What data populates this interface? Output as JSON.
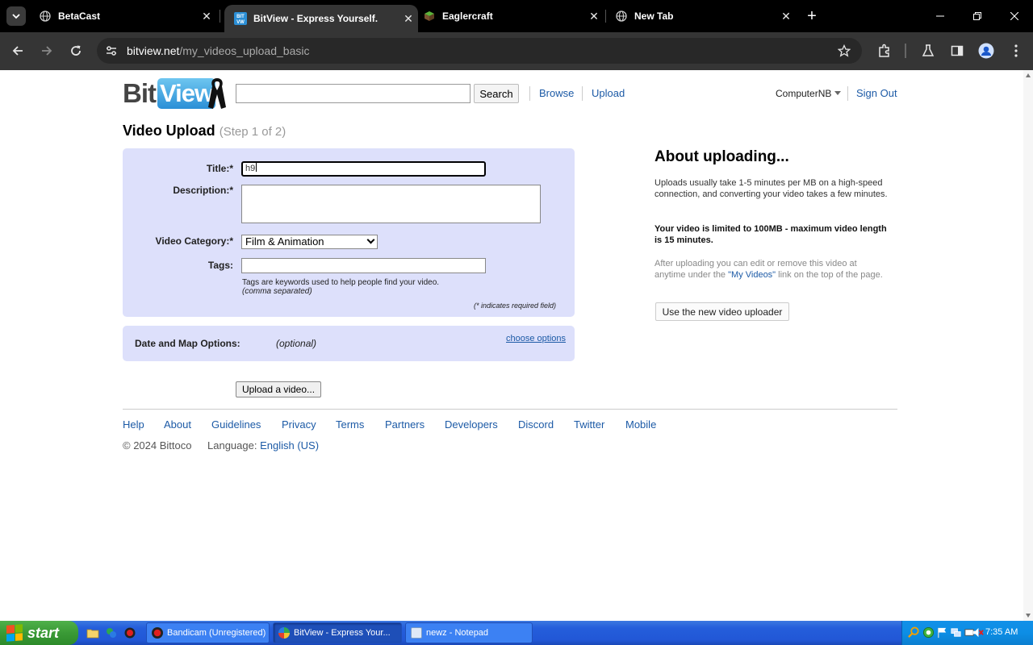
{
  "browser": {
    "tabs": [
      {
        "title": "BetaCast",
        "active": false
      },
      {
        "title": "BitView - Express Yourself.",
        "active": true
      },
      {
        "title": "Eaglercraft",
        "active": false
      },
      {
        "title": "New Tab",
        "active": false
      }
    ],
    "close_glyph": "✕",
    "new_tab_glyph": "+",
    "url_host": "bitview.net",
    "url_path": "/my_videos_upload_basic"
  },
  "site": {
    "logo_bit": "Bit",
    "logo_view": "View",
    "search_button": "Search",
    "nav": {
      "browse": "Browse",
      "upload": "Upload"
    },
    "username": "ComputerNB",
    "sign_out": "Sign Out"
  },
  "form": {
    "page_title": "Video Upload",
    "step": "(Step 1 of 2)",
    "title_label": "Title:*",
    "title_value": "h9",
    "description_label": "Description:*",
    "category_label": "Video Category:*",
    "category_value": "Film & Animation",
    "tags_label": "Tags:",
    "tags_help": "Tags are keywords used to help people find your video.",
    "tags_help_sub": "(comma separated)",
    "required_note": "(* indicates required field)",
    "date_label": "Date and Map Options:",
    "date_optional": "(optional)",
    "choose_options": "choose options",
    "upload_button": "Upload a video..."
  },
  "about": {
    "title": "About uploading...",
    "p1": "Uploads usually take 1-5 minutes per MB on a high-speed connection, and converting your video takes a few minutes.",
    "p2": "Your video is limited to 100MB - maximum video length is 15 minutes.",
    "p3_before": "After uploading you can edit or remove this video at anytime under the ",
    "p3_link": "\"My Videos\"",
    "p3_after": " link on the top of the page.",
    "new_uploader_button": "Use the new video uploader"
  },
  "footer": {
    "links": [
      "Help",
      "About",
      "Guidelines",
      "Privacy",
      "Terms",
      "Partners",
      "Developers",
      "Discord",
      "Twitter",
      "Mobile"
    ],
    "copyright": "© 2024 Bittoco",
    "language_label": "Language:",
    "language_value": "English (US)"
  },
  "taskbar": {
    "start": "start",
    "tasks": [
      {
        "label": "Bandicam (Unregistered)"
      },
      {
        "label": "BitView - Express Your..."
      },
      {
        "label": "newz - Notepad"
      }
    ],
    "clock": "7:35 AM"
  },
  "colors": {
    "link": "#1c5aa6",
    "form_bg": "#dde0fb",
    "browser_bg": "#353535"
  }
}
